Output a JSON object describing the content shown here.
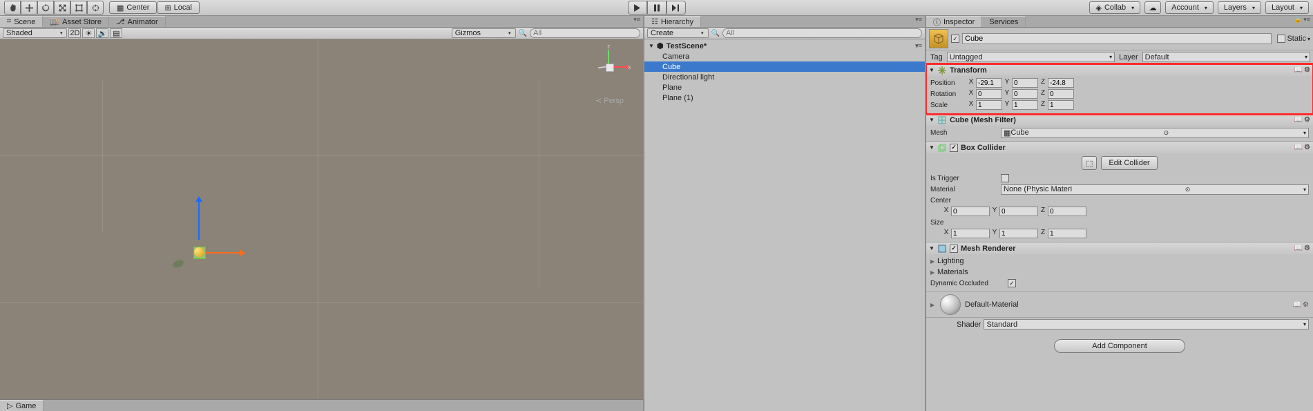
{
  "topbar": {
    "center": "Center",
    "local": "Local",
    "collab": "Collab",
    "account": "Account",
    "layers": "Layers",
    "layout": "Layout"
  },
  "tabs": {
    "scene": "Scene",
    "asset_store": "Asset Store",
    "animator": "Animator",
    "game": "Game",
    "hierarchy": "Hierarchy",
    "inspector": "Inspector",
    "services": "Services"
  },
  "scene": {
    "shaded": "Shaded",
    "mode2d": "2D",
    "gizmos": "Gizmos",
    "search_placeholder": "All",
    "persp": "Persp",
    "axis_x": "x",
    "axis_y": "y",
    "axis_z": "z"
  },
  "hierarchy": {
    "create": "Create",
    "search_placeholder": "All",
    "scene": "TestScene*",
    "items": [
      "Camera",
      "Cube",
      "Directional light",
      "Plane",
      "Plane (1)"
    ],
    "selected_index": 1
  },
  "inspector": {
    "name": "Cube",
    "static": "Static",
    "tag_label": "Tag",
    "tag_value": "Untagged",
    "layer_label": "Layer",
    "layer_value": "Default",
    "transform": {
      "title": "Transform",
      "position_label": "Position",
      "rotation_label": "Rotation",
      "scale_label": "Scale",
      "position": {
        "x": "-29.1",
        "y": "0",
        "z": "-24.8"
      },
      "rotation": {
        "x": "0",
        "y": "0",
        "z": "0"
      },
      "scale": {
        "x": "1",
        "y": "1",
        "z": "1"
      }
    },
    "mesh_filter": {
      "title": "Cube (Mesh Filter)",
      "mesh_label": "Mesh",
      "mesh_value": "Cube"
    },
    "box_collider": {
      "title": "Box Collider",
      "edit": "Edit Collider",
      "is_trigger": "Is Trigger",
      "material_label": "Material",
      "material_value": "None (Physic Materi",
      "center_label": "Center",
      "center": {
        "x": "0",
        "y": "0",
        "z": "0"
      },
      "size_label": "Size",
      "size": {
        "x": "1",
        "y": "1",
        "z": "1"
      }
    },
    "mesh_renderer": {
      "title": "Mesh Renderer",
      "lighting": "Lighting",
      "materials": "Materials",
      "dyn_occluded": "Dynamic Occluded"
    },
    "material": {
      "name": "Default-Material",
      "shader_label": "Shader",
      "shader_value": "Standard"
    },
    "add_component": "Add Component"
  },
  "labels": {
    "x": "X",
    "y": "Y",
    "z": "Z"
  }
}
